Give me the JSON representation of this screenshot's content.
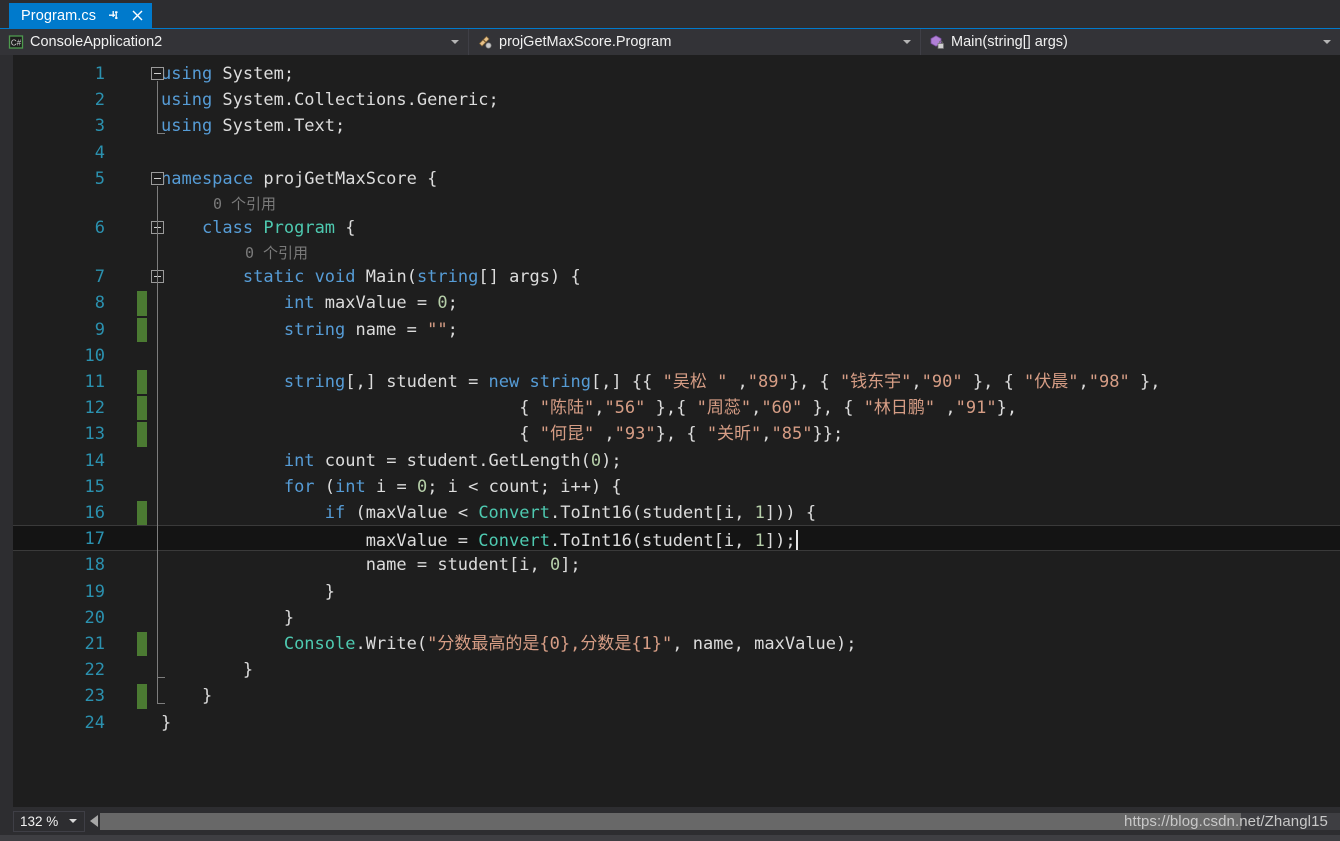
{
  "tab": {
    "title": "Program.cs",
    "pin_icon": "pin-icon",
    "close_icon": "close-icon"
  },
  "navbar": {
    "project": {
      "icon": "csharp-project-icon",
      "label": "ConsoleApplication2"
    },
    "type": {
      "icon": "class-members-icon",
      "label": "projGetMaxScore.Program"
    },
    "member": {
      "icon": "method-private-icon",
      "label": "Main(string[] args)"
    }
  },
  "editor": {
    "current_line": 17,
    "codelens": [
      {
        "after_line": 5,
        "text": "0 个引用"
      },
      {
        "after_line": 6,
        "text": "0 个引用"
      }
    ],
    "change_bar_lines": [
      8,
      9,
      11,
      12,
      13,
      16,
      21,
      23
    ],
    "fold_lines": [
      1,
      5,
      6,
      7
    ],
    "lines": [
      {
        "n": 1,
        "tokens": [
          {
            "t": "using",
            "c": "kw"
          },
          {
            "t": " System;",
            "c": "pln"
          }
        ]
      },
      {
        "n": 2,
        "tokens": [
          {
            "t": "using",
            "c": "kw"
          },
          {
            "t": " System.Collections.Generic;",
            "c": "pln"
          }
        ]
      },
      {
        "n": 3,
        "tokens": [
          {
            "t": "using",
            "c": "kw"
          },
          {
            "t": " System.Text;",
            "c": "pln"
          }
        ]
      },
      {
        "n": 4,
        "tokens": []
      },
      {
        "n": 5,
        "tokens": [
          {
            "t": "namespace",
            "c": "kw"
          },
          {
            "t": " projGetMaxScore {",
            "c": "pln"
          }
        ]
      },
      {
        "n": 6,
        "tokens": [
          {
            "t": "    ",
            "c": "pln"
          },
          {
            "t": "class",
            "c": "kw"
          },
          {
            "t": " ",
            "c": "pln"
          },
          {
            "t": "Program",
            "c": "type"
          },
          {
            "t": " {",
            "c": "pln"
          }
        ]
      },
      {
        "n": 7,
        "tokens": [
          {
            "t": "        ",
            "c": "pln"
          },
          {
            "t": "static",
            "c": "kw"
          },
          {
            "t": " ",
            "c": "pln"
          },
          {
            "t": "void",
            "c": "kw"
          },
          {
            "t": " Main(",
            "c": "pln"
          },
          {
            "t": "string",
            "c": "kw"
          },
          {
            "t": "[] args) {",
            "c": "pln"
          }
        ]
      },
      {
        "n": 8,
        "tokens": [
          {
            "t": "            ",
            "c": "pln"
          },
          {
            "t": "int",
            "c": "kw"
          },
          {
            "t": " maxValue = ",
            "c": "pln"
          },
          {
            "t": "0",
            "c": "num"
          },
          {
            "t": ";",
            "c": "pln"
          }
        ]
      },
      {
        "n": 9,
        "tokens": [
          {
            "t": "            ",
            "c": "pln"
          },
          {
            "t": "string",
            "c": "kw"
          },
          {
            "t": " name = ",
            "c": "pln"
          },
          {
            "t": "\"\"",
            "c": "str"
          },
          {
            "t": ";",
            "c": "pln"
          }
        ]
      },
      {
        "n": 10,
        "tokens": []
      },
      {
        "n": 11,
        "tokens": [
          {
            "t": "            ",
            "c": "pln"
          },
          {
            "t": "string",
            "c": "kw"
          },
          {
            "t": "[,] student = ",
            "c": "pln"
          },
          {
            "t": "new",
            "c": "kw"
          },
          {
            "t": " ",
            "c": "pln"
          },
          {
            "t": "string",
            "c": "kw"
          },
          {
            "t": "[,] {{ ",
            "c": "pln"
          },
          {
            "t": "\"吴松 \"",
            "c": "str"
          },
          {
            "t": " ,",
            "c": "pln"
          },
          {
            "t": "\"89\"",
            "c": "str"
          },
          {
            "t": "}, { ",
            "c": "pln"
          },
          {
            "t": "\"钱东宇\"",
            "c": "str"
          },
          {
            "t": ",",
            "c": "pln"
          },
          {
            "t": "\"90\"",
            "c": "str"
          },
          {
            "t": " }, { ",
            "c": "pln"
          },
          {
            "t": "\"伏晨\"",
            "c": "str"
          },
          {
            "t": ",",
            "c": "pln"
          },
          {
            "t": "\"98\"",
            "c": "str"
          },
          {
            "t": " },",
            "c": "pln"
          }
        ]
      },
      {
        "n": 12,
        "tokens": [
          {
            "t": "                                   { ",
            "c": "pln"
          },
          {
            "t": "\"陈陆\"",
            "c": "str"
          },
          {
            "t": ",",
            "c": "pln"
          },
          {
            "t": "\"56\"",
            "c": "str"
          },
          {
            "t": " },{ ",
            "c": "pln"
          },
          {
            "t": "\"周蕊\"",
            "c": "str"
          },
          {
            "t": ",",
            "c": "pln"
          },
          {
            "t": "\"60\"",
            "c": "str"
          },
          {
            "t": " }, { ",
            "c": "pln"
          },
          {
            "t": "\"林日鹏\"",
            "c": "str"
          },
          {
            "t": " ,",
            "c": "pln"
          },
          {
            "t": "\"91\"",
            "c": "str"
          },
          {
            "t": "},",
            "c": "pln"
          }
        ]
      },
      {
        "n": 13,
        "tokens": [
          {
            "t": "                                   { ",
            "c": "pln"
          },
          {
            "t": "\"何昆\"",
            "c": "str"
          },
          {
            "t": " ,",
            "c": "pln"
          },
          {
            "t": "\"93\"",
            "c": "str"
          },
          {
            "t": "}, { ",
            "c": "pln"
          },
          {
            "t": "\"关昕\"",
            "c": "str"
          },
          {
            "t": ",",
            "c": "pln"
          },
          {
            "t": "\"85\"",
            "c": "str"
          },
          {
            "t": "}};",
            "c": "pln"
          }
        ]
      },
      {
        "n": 14,
        "tokens": [
          {
            "t": "            ",
            "c": "pln"
          },
          {
            "t": "int",
            "c": "kw"
          },
          {
            "t": " count = student.GetLength(",
            "c": "pln"
          },
          {
            "t": "0",
            "c": "num"
          },
          {
            "t": ");",
            "c": "pln"
          }
        ]
      },
      {
        "n": 15,
        "tokens": [
          {
            "t": "            ",
            "c": "pln"
          },
          {
            "t": "for",
            "c": "kw"
          },
          {
            "t": " (",
            "c": "pln"
          },
          {
            "t": "int",
            "c": "kw"
          },
          {
            "t": " i = ",
            "c": "pln"
          },
          {
            "t": "0",
            "c": "num"
          },
          {
            "t": "; i < count; i++) {",
            "c": "pln"
          }
        ]
      },
      {
        "n": 16,
        "tokens": [
          {
            "t": "                ",
            "c": "pln"
          },
          {
            "t": "if",
            "c": "kw"
          },
          {
            "t": " (maxValue < ",
            "c": "pln"
          },
          {
            "t": "Convert",
            "c": "type"
          },
          {
            "t": ".ToInt16(student[i, ",
            "c": "pln"
          },
          {
            "t": "1",
            "c": "num"
          },
          {
            "t": "])) {",
            "c": "pln"
          }
        ]
      },
      {
        "n": 17,
        "tokens": [
          {
            "t": "                    maxValue = ",
            "c": "pln"
          },
          {
            "t": "Convert",
            "c": "type"
          },
          {
            "t": ".ToInt16(student[i, ",
            "c": "pln"
          },
          {
            "t": "1",
            "c": "num"
          },
          {
            "t": "]);",
            "c": "pln"
          }
        ]
      },
      {
        "n": 18,
        "tokens": [
          {
            "t": "                    name = student[i, ",
            "c": "pln"
          },
          {
            "t": "0",
            "c": "num"
          },
          {
            "t": "];",
            "c": "pln"
          }
        ]
      },
      {
        "n": 19,
        "tokens": [
          {
            "t": "                }",
            "c": "pln"
          }
        ]
      },
      {
        "n": 20,
        "tokens": [
          {
            "t": "            }",
            "c": "pln"
          }
        ]
      },
      {
        "n": 21,
        "tokens": [
          {
            "t": "            ",
            "c": "pln"
          },
          {
            "t": "Console",
            "c": "type"
          },
          {
            "t": ".Write(",
            "c": "pln"
          },
          {
            "t": "\"分数最高的是{0},分数是{1}\"",
            "c": "str"
          },
          {
            "t": ", name, maxValue);",
            "c": "pln"
          }
        ]
      },
      {
        "n": 22,
        "tokens": [
          {
            "t": "        }",
            "c": "pln"
          }
        ]
      },
      {
        "n": 23,
        "tokens": [
          {
            "t": "    }",
            "c": "pln"
          }
        ]
      },
      {
        "n": 24,
        "tokens": [
          {
            "t": "}",
            "c": "pln"
          }
        ]
      }
    ]
  },
  "statusbar": {
    "zoom": "132 %",
    "watermark": "https://blog.csdn.net/Zhangl15"
  },
  "colors": {
    "tab_active": "#007acc",
    "keyword": "#569cd6",
    "type": "#4ec9b0",
    "string": "#d69d85",
    "number": "#b5cea8",
    "linenumber": "#2b91af",
    "editor_bg": "#1e1e1e",
    "chrome_bg": "#2d2d30",
    "changebar": "#4b7a32"
  }
}
